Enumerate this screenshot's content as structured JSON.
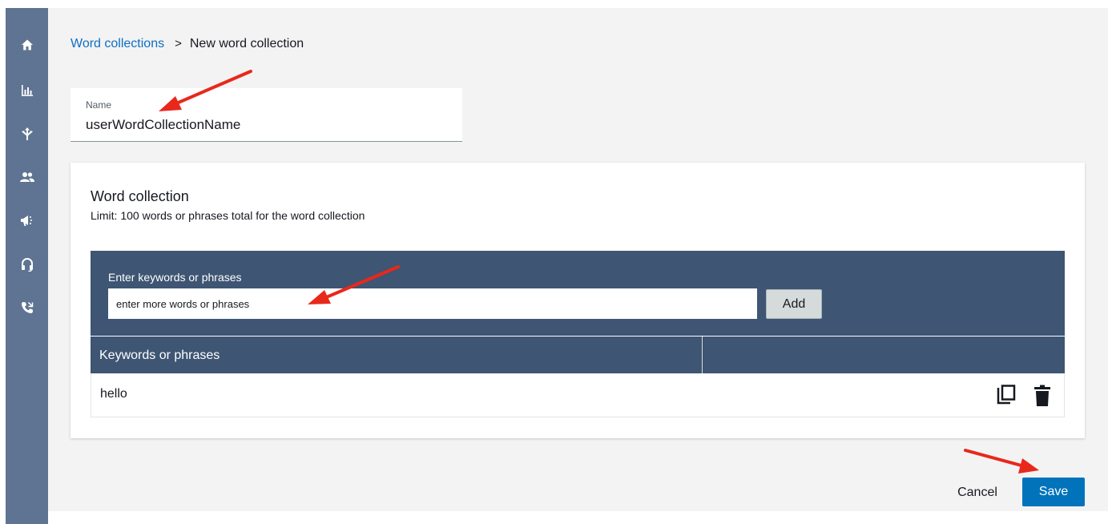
{
  "sidebar": {
    "items": [
      {
        "icon": "home-icon"
      },
      {
        "icon": "bar-chart-icon"
      },
      {
        "icon": "routing-icon"
      },
      {
        "icon": "users-icon"
      },
      {
        "icon": "megaphone-icon"
      },
      {
        "icon": "headset-icon"
      },
      {
        "icon": "phone-icon"
      }
    ]
  },
  "breadcrumb": {
    "parent": "Word collections",
    "separator": ">",
    "current": "New word collection"
  },
  "name_field": {
    "label": "Name",
    "value": "userWordCollectionName"
  },
  "word_collection": {
    "title": "Word collection",
    "subtitle": "Limit: 100 words or phrases total for the word collection",
    "entry_label": "Enter keywords or phrases",
    "entry_placeholder": "enter more words or phrases",
    "add_label": "Add",
    "table": {
      "column_header": "Keywords or phrases",
      "rows": [
        {
          "text": "hello",
          "actions": [
            "copy-icon",
            "delete-icon"
          ]
        }
      ]
    }
  },
  "footer": {
    "cancel_label": "Cancel",
    "save_label": "Save"
  },
  "colors": {
    "sidebar": "#5f7492",
    "panel": "#3e5573",
    "link": "#0f6ec2",
    "primary": "#0073bb",
    "annotation_arrow": "#e8281b"
  }
}
